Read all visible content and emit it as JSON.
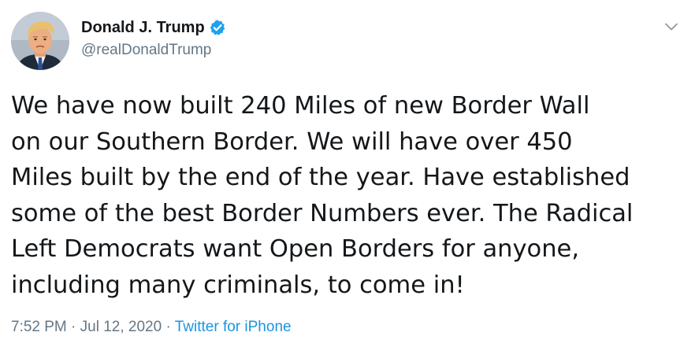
{
  "author": {
    "display_name": "Donald J. Trump",
    "handle": "@realDonaldTrump",
    "verified": true,
    "avatar_icon": "profile-photo",
    "verified_icon": "verified-badge-icon",
    "verified_color": "#1da1f2"
  },
  "menu": {
    "icon": "chevron-down-icon"
  },
  "tweet": {
    "text_lines": [
      "We have now built 240 Miles of new Border Wall",
      "on our Southern Border. We will have over 450",
      "Miles built by the end of the year. Have established",
      "some of the best Border Numbers ever. The Radical",
      "Left Democrats want Open Borders for anyone,",
      "including many criminals, to come in!"
    ],
    "time": "7:52 PM",
    "separator": "·",
    "date": "Jul 12, 2020",
    "source": "Twitter for iPhone"
  },
  "colors": {
    "text": "#14171a",
    "secondary_text": "#657786",
    "link": "#1b95e0"
  }
}
